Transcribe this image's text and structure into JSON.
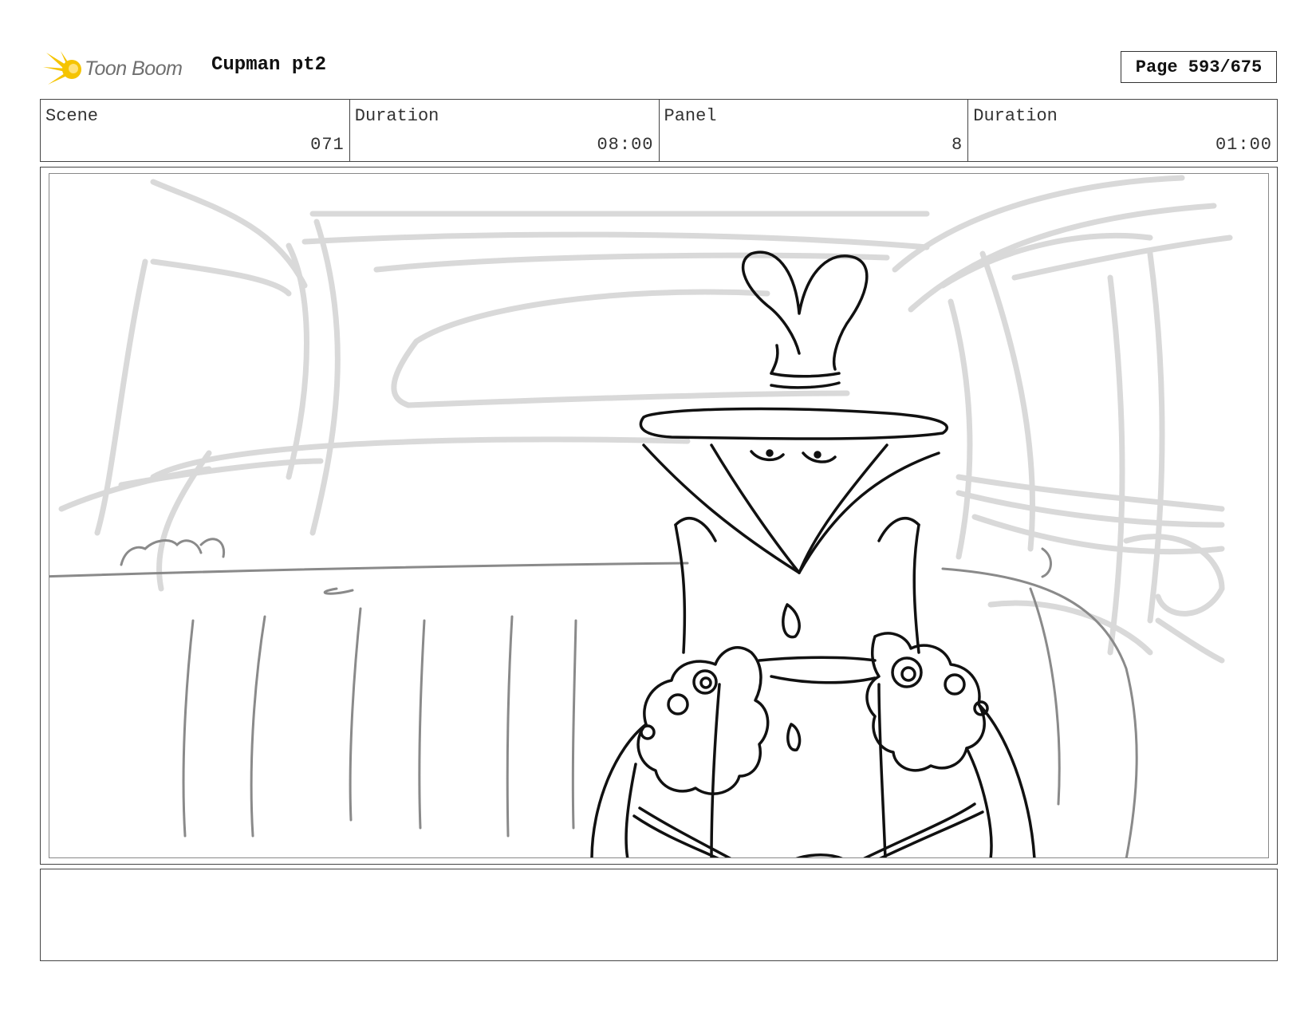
{
  "header": {
    "logo_text": "Toon Boom",
    "project_title": "Cupman pt2",
    "page_label": "Page 593/675"
  },
  "info": {
    "scene_label": "Scene",
    "scene_value": "071",
    "scene_duration_label": "Duration",
    "scene_duration_value": "08:00",
    "panel_label": "Panel",
    "panel_value": "8",
    "panel_duration_label": "Duration",
    "panel_duration_value": "01:00"
  },
  "colors": {
    "logo_accent": "#f5c400",
    "sketch_light": "#d9d9d9",
    "sketch_mid": "#9a9a9a",
    "ink": "#111111"
  },
  "notes": ""
}
